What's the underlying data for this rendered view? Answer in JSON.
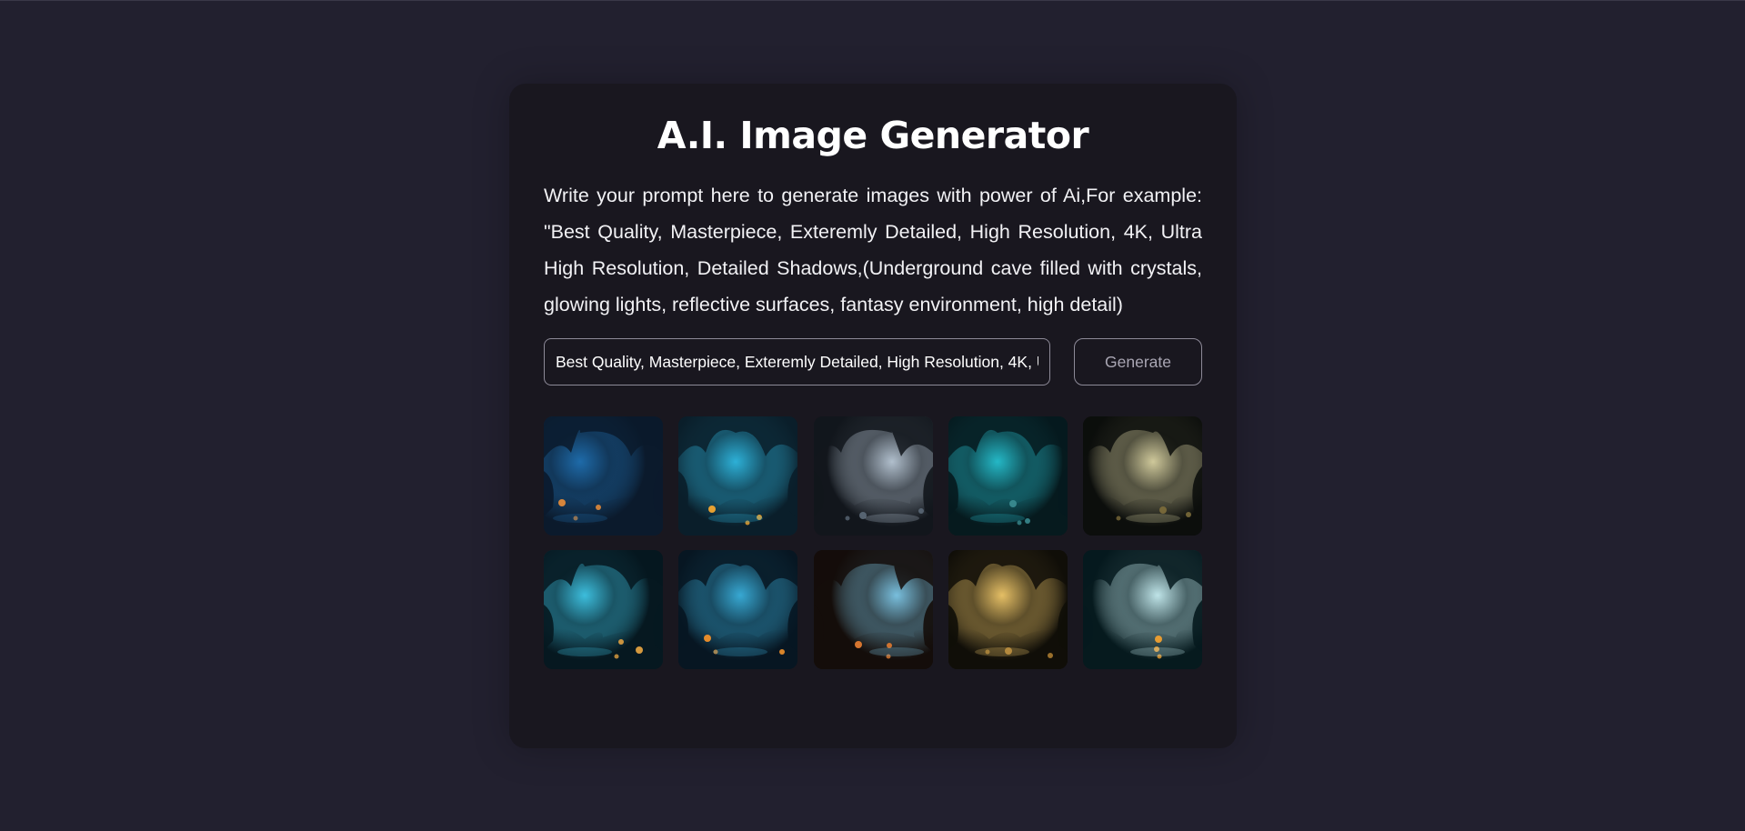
{
  "app": {
    "title": "A.I. Image Generator",
    "description": "Write your prompt here to generate images with power of Ai,For example: \"Best Quality, Masterpiece, Exteremly Detailed, High Resolution, 4K, Ultra High Resolution, Detailed Shadows,(Underground cave filled with crystals, glowing lights, reflective surfaces, fantasy environment, high detail)"
  },
  "prompt": {
    "value": "Best Quality, Masterpiece, Exteremly Detailed, High Resolution, 4K, Ultra High Resolution, Detailed Shadows,(Underground cave filled with crystals, glowing lights, reflective surfaces, fantasy environment, high detail)"
  },
  "generate_button": {
    "label": "Generate"
  },
  "colors": {
    "page_background": "#22202f",
    "card_background": "#19171f",
    "input_border": "#8d8a98",
    "button_text": "#a9a6b3"
  },
  "gallery": {
    "images": [
      {
        "name": "cave-image-1",
        "palette": [
          "#0b1a2c",
          "#1f6fb0",
          "#e08a3a"
        ]
      },
      {
        "name": "cave-image-2",
        "palette": [
          "#0a1e2a",
          "#2fb8e0",
          "#f2a630"
        ]
      },
      {
        "name": "cave-image-3",
        "palette": [
          "#12161c",
          "#b9c8d6",
          "#5a6775"
        ]
      },
      {
        "name": "cave-image-4",
        "palette": [
          "#061a1e",
          "#26c0cf",
          "#3a8a8f"
        ]
      },
      {
        "name": "cave-image-5",
        "palette": [
          "#0c0e0c",
          "#d9d2a2",
          "#7a6a3a"
        ]
      },
      {
        "name": "cave-image-6",
        "palette": [
          "#061820",
          "#3fc6e6",
          "#e0a040"
        ]
      },
      {
        "name": "cave-image-7",
        "palette": [
          "#071622",
          "#3ab0dc",
          "#f0902a"
        ]
      },
      {
        "name": "cave-image-8",
        "palette": [
          "#140d0a",
          "#7ec8e8",
          "#e07a30"
        ]
      },
      {
        "name": "cave-image-9",
        "palette": [
          "#100e08",
          "#f0c86a",
          "#a87a30"
        ]
      },
      {
        "name": "cave-image-10",
        "palette": [
          "#061a1e",
          "#c8eef2",
          "#f0a030"
        ]
      }
    ]
  }
}
